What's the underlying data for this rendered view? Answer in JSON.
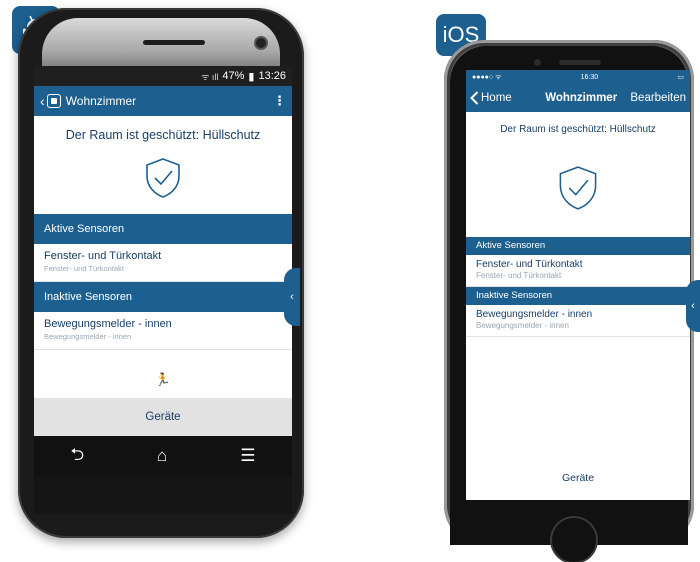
{
  "colors": {
    "accent": "#1d5f8e",
    "text_dark": "#1a3f66",
    "text_muted": "#9aa7b5"
  },
  "badges": {
    "android_icon": "android-icon",
    "ios_label": "iOS"
  },
  "android": {
    "status": {
      "battery": "47%",
      "time": "13:26"
    },
    "appbar": {
      "back": "‹",
      "title": "Wohnzimmer",
      "menu": "⋮"
    },
    "protection_text": "Der Raum ist geschützt:  Hüllschutz",
    "active_header": "Aktive Sensoren",
    "active_items": [
      {
        "primary": "Fenster- und Türkontakt",
        "secondary": "Fenster- und Türkontakt"
      }
    ],
    "inactive_header": "Inaktive Sensoren",
    "inactive_items": [
      {
        "primary": "Bewegungsmelder - innen",
        "secondary": "Bewegungsmelder - innen"
      }
    ],
    "running_icon": "🏃",
    "devices_label": "Geräte",
    "side_tab": "‹",
    "navbar": {
      "back": "⮌",
      "home": "⌂",
      "menu": "☰"
    }
  },
  "ios": {
    "status": {
      "carrier": "●●●●○ ᯤ",
      "time": "16:30",
      "battery": "▭"
    },
    "nav": {
      "back": "Home",
      "title": "Wohnzimmer",
      "edit": "Bearbeiten"
    },
    "protection_text": "Der Raum ist geschützt: Hüllschutz",
    "active_header": "Aktive Sensoren",
    "active_items": [
      {
        "primary": "Fenster- und Türkontakt",
        "secondary": "Fenster- und Türkontakt"
      }
    ],
    "inactive_header": "Inaktive Sensoren",
    "inactive_items": [
      {
        "primary": "Bewegungsmelder - innen",
        "secondary": "Bewegungsmelder - innen"
      }
    ],
    "devices_label": "Geräte",
    "side_tab": "‹"
  }
}
